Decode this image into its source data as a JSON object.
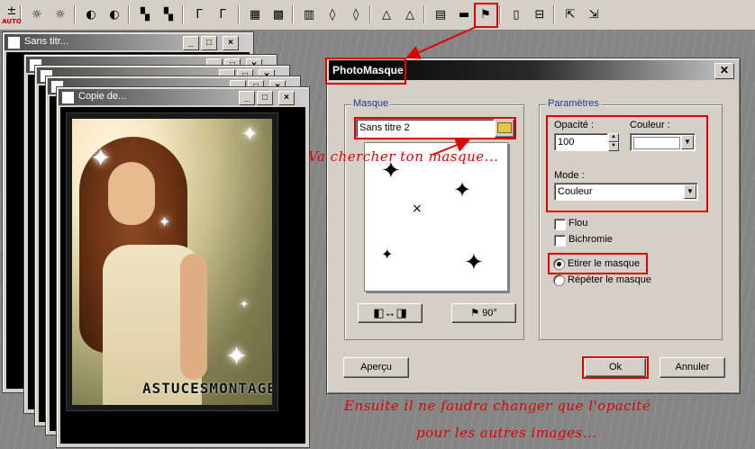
{
  "toolbar": {
    "auto_label": "AUTO",
    "buttons": [
      {
        "icon": "auto-fix-icon",
        "glyph": "±"
      },
      {
        "icon": "brightness-icon",
        "glyph": "☼"
      },
      {
        "icon": "brightness-plus-icon",
        "glyph": "☼"
      },
      {
        "icon": "hue-icon",
        "glyph": "◐"
      },
      {
        "icon": "hue-plus-icon",
        "glyph": "◐"
      },
      {
        "icon": "color-balance-icon",
        "glyph": "▚"
      },
      {
        "icon": "color-balance-plus-icon",
        "glyph": "▚"
      },
      {
        "icon": "gamma-icon",
        "glyph": "Γ"
      },
      {
        "icon": "gamma-plus-icon",
        "glyph": "Γ"
      },
      {
        "icon": "grid-icon",
        "glyph": "▦"
      },
      {
        "icon": "texture-icon",
        "glyph": "▩"
      },
      {
        "icon": "sharpen-icon",
        "glyph": "▥"
      },
      {
        "icon": "drop-icon",
        "glyph": "◊"
      },
      {
        "icon": "drop-outline-icon",
        "glyph": "◊"
      },
      {
        "icon": "triangle-icon",
        "glyph": "△"
      },
      {
        "icon": "triangle-outline-icon",
        "glyph": "△"
      },
      {
        "icon": "gradient-icon",
        "glyph": "▤"
      },
      {
        "icon": "blue-gradient-icon",
        "glyph": "▬"
      },
      {
        "icon": "photomasque-icon",
        "glyph": "⚑"
      },
      {
        "icon": "frame-icon",
        "glyph": "▯"
      },
      {
        "icon": "split-icon",
        "glyph": "⊟"
      },
      {
        "icon": "export-icon",
        "glyph": "⇱"
      },
      {
        "icon": "import-icon",
        "glyph": "⇲"
      }
    ]
  },
  "doc_windows": [
    {
      "title": "Sans titr..."
    },
    {
      "title": ""
    },
    {
      "title": ""
    },
    {
      "title": ""
    },
    {
      "title": "Copie de..."
    }
  ],
  "photo": {
    "signature": "ASTUCESMONTAGES"
  },
  "dialog": {
    "title": "PhotoMasque",
    "close_glyph": "✕",
    "masque_group": "Masque",
    "mask_file": "Sans titre 2",
    "open_icon": "folder-open-icon",
    "invert_button_glyph": "◧↔◨",
    "rotate_button_glyph": "⚑ 90°",
    "params_group": "Paramètres",
    "opacity_label": "Opacité :",
    "opacity_value": "100",
    "color_label": "Couleur :",
    "mode_label": "Mode :",
    "mode_value": "Couleur",
    "flou_label": "Flou",
    "bichromie_label": "Bichromie",
    "stretch_label": "Etirer le masque",
    "repeat_label": "Répéter le masque",
    "preview_button": "Aperçu",
    "ok_button": "Ok",
    "cancel_button": "Annuler"
  },
  "annotations": {
    "note1": "Va chercher ton masque...",
    "note2_line1": "Ensuite il ne faudra changer que l'opacité",
    "note2_line2": "pour les autres images..."
  },
  "colors": {
    "annotation_red": "#e00000",
    "dialog_face": "#d4d0c8",
    "group_label_blue": "#1a3d8f"
  }
}
